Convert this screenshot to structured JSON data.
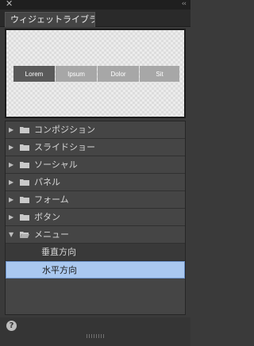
{
  "window": {
    "close_glyph": "✕",
    "collapse_glyph": "‹‹"
  },
  "panel": {
    "tab_title": "ウィジェットライブラリ"
  },
  "preview": {
    "menu_items": [
      "Lorem",
      "Ipsum",
      "Dolor",
      "Sit"
    ],
    "active_index": 0
  },
  "tree": {
    "items": [
      {
        "label": "コンポジション",
        "expanded": false
      },
      {
        "label": "スライドショー",
        "expanded": false
      },
      {
        "label": "ソーシャル",
        "expanded": false
      },
      {
        "label": "パネル",
        "expanded": false
      },
      {
        "label": "フォーム",
        "expanded": false
      },
      {
        "label": "ボタン",
        "expanded": false
      },
      {
        "label": "メニュー",
        "expanded": true,
        "children": [
          {
            "label": "垂直方向",
            "selected": false
          },
          {
            "label": "水平方向",
            "selected": true
          }
        ]
      }
    ]
  },
  "footer": {
    "help_glyph": "?"
  },
  "colors": {
    "selection_bg": "#aac8ef",
    "panel_bg": "#454545",
    "active_menu": "#5a5a5a",
    "menu_button": "#a7a7a7"
  }
}
